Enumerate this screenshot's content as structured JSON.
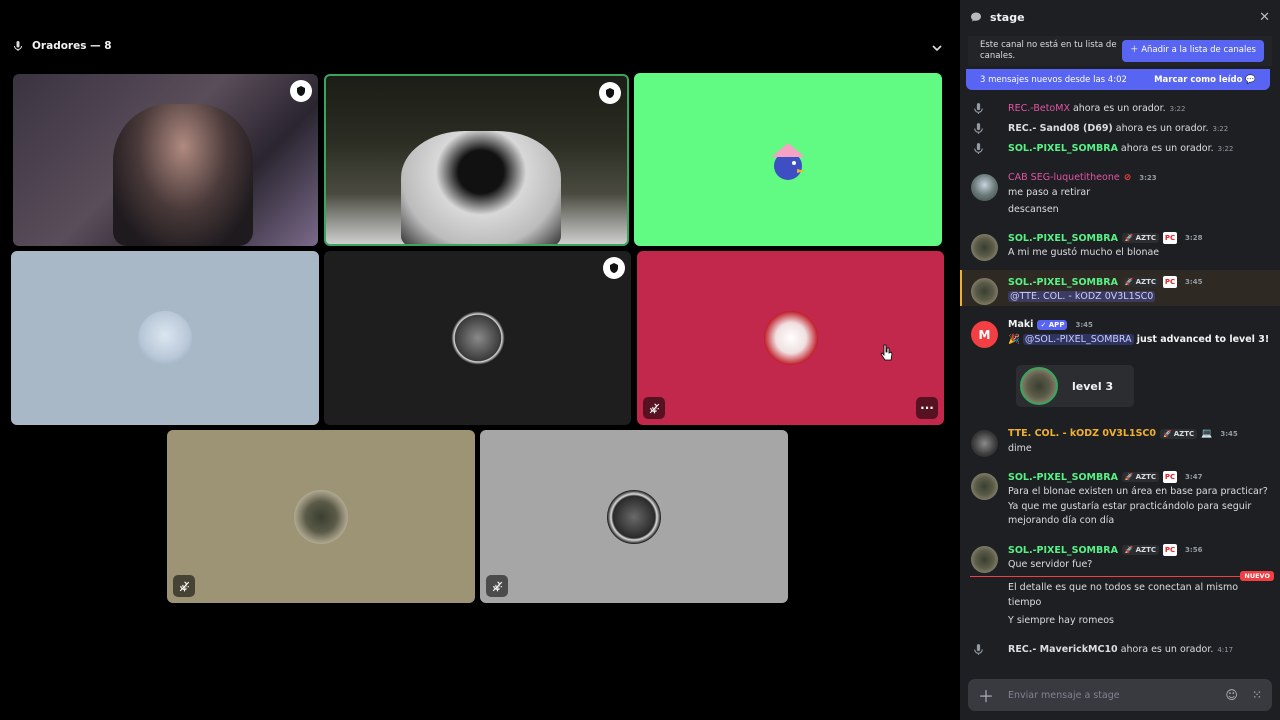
{
  "stage": {
    "speakers_label": "Oradores — 8"
  },
  "chat": {
    "channel_name": "stage",
    "notice_text": "Este canal no está en tu lista de canales.",
    "add_button": "Añadir a la lista de canales",
    "new_messages": "3 mensajes nuevos desde las 4:02",
    "mark_read": "Marcar como leído",
    "system_events": [
      {
        "name": "REC.-BetoMX",
        "text": "ahora es un orador.",
        "time": "3:22",
        "color": "#e255a6"
      },
      {
        "name": "REC.- Sand08 (D69)",
        "text": "ahora es un orador.",
        "time": "3:22",
        "color": "#f2f3f5"
      },
      {
        "name": "SOL.-PIXEL_SOMBRA",
        "text": "ahora es un orador.",
        "time": "3:22",
        "color": "#57f287"
      },
      {
        "name": "REC.- MaverickMC10",
        "text": "ahora es un orador.",
        "time": "4:17",
        "color": "#f2f3f5"
      }
    ],
    "messages": [
      {
        "author": "CAB SEG-luquetitheone",
        "time": "3:23",
        "color": "#e255a6",
        "lines": [
          "me paso a retirar",
          "descansen"
        ]
      },
      {
        "author": "SOL.-PIXEL_SOMBRA",
        "tag": "AZTC",
        "pc": "PC",
        "time": "3:28",
        "color": "#57f287",
        "lines": [
          "A mi me gustó mucho el blonae"
        ]
      },
      {
        "author": "SOL.-PIXEL_SOMBRA",
        "tag": "AZTC",
        "pc": "PC",
        "time": "3:45",
        "color": "#57f287",
        "mention": "@TTE. COL. - kODZ 0V3L1SC0"
      },
      {
        "author": "Maki",
        "app": "APP",
        "time": "3:45",
        "color": "#f2f3f5",
        "mention": "@SOL.-PIXEL_SOMBRA",
        "bold_text": "just advanced to level 3!",
        "level": "level 3"
      },
      {
        "author": "TTE. COL. - kODZ 0V3L1SC0",
        "tag": "AZTC",
        "time": "3:45",
        "color": "#f0b132",
        "lines": [
          "dime"
        ]
      },
      {
        "author": "SOL.-PIXEL_SOMBRA",
        "tag": "AZTC",
        "pc": "PC",
        "time": "3:47",
        "color": "#57f287",
        "lines": [
          "Para el blonae existen un área en base para practicar? Ya que me gustaría estar practicándolo para seguir mejorando día con día"
        ]
      },
      {
        "author": "SOL.-PIXEL_SOMBRA",
        "tag": "AZTC",
        "pc": "PC",
        "time": "3:56",
        "color": "#57f287",
        "lines": [
          "Que servidor fue?"
        ],
        "continued": [
          "El detalle es que no todos se conectan al mismo tiempo",
          "Y siempre hay romeos"
        ]
      }
    ],
    "nuevo_label": "NUEVO",
    "composer_placeholder": "Enviar mensaje a stage"
  }
}
